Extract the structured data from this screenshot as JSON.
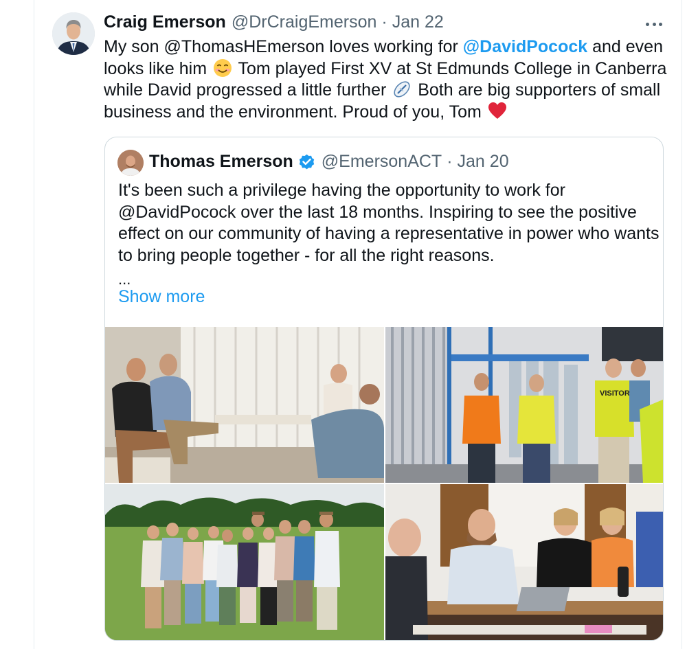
{
  "tweet": {
    "author_name": "Craig Emerson",
    "author_handle": "@DrCraigEmerson",
    "separator": "·",
    "date": "Jan 22",
    "more_icon": "more-horizontal-icon",
    "text_line1_pre": "My son @ThomasHEmerson loves working for ",
    "text_line1_mention": "@DavidPocock",
    "text_line1_post": " and even",
    "text_line2_pre": "looks like him ",
    "text_line2_post": " Tom played First XV at St Edmunds College in Canberra",
    "text_line3_pre": "while David progressed a little further ",
    "text_line3_post": " Both are big supporters of small",
    "text_line4_pre": "business and the environment. Proud of you, Tom ",
    "emoji_smiling": "smiling-face-emoji",
    "emoji_rugby": "rugby-ball-emoji",
    "emoji_heart": "red-heart-emoji"
  },
  "quote": {
    "author_name": "Thomas Emerson",
    "verified_icon": "verified-badge-icon",
    "author_handle": "@EmersonACT",
    "separator": "·",
    "date": "Jan 20",
    "line1": "It's been such a privilege having the opportunity to work for",
    "line2": "@DavidPocock over the last 18 months. Inspiring to see the positive",
    "line3": "effect on our community of having a representative in power who wants",
    "line4": "to bring people together - for all the right reasons.",
    "ellipsis": "...",
    "show_more": "Show more",
    "photo_badge_text": "VISITOR"
  },
  "colors": {
    "link": "#1d9bf0",
    "text": "#0f1419",
    "secondary": "#536471",
    "border": "#cfd9de"
  }
}
